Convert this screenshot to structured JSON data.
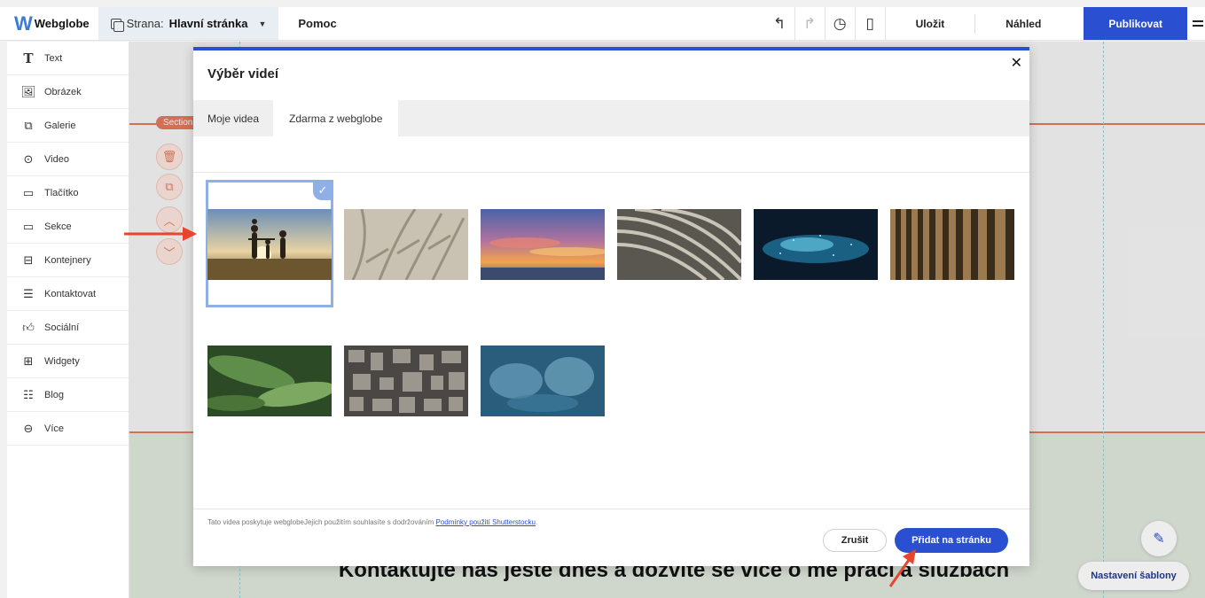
{
  "topbar": {
    "logo_text": "Webglobe",
    "page_prefix": "Strana:",
    "page_name": "Hlavní stránka",
    "help": "Pomoc",
    "save": "Uložit",
    "preview": "Náhled",
    "publish": "Publikovat"
  },
  "sidebar": {
    "items": [
      {
        "label": "Text",
        "icon": "text-icon"
      },
      {
        "label": "Obrázek",
        "icon": "image-icon"
      },
      {
        "label": "Galerie",
        "icon": "gallery-icon"
      },
      {
        "label": "Video",
        "icon": "video-icon"
      },
      {
        "label": "Tlačítko",
        "icon": "button-icon"
      },
      {
        "label": "Sekce",
        "icon": "section-icon"
      },
      {
        "label": "Kontejnery",
        "icon": "container-icon"
      },
      {
        "label": "Kontaktovat",
        "icon": "contact-form-icon"
      },
      {
        "label": "Sociální",
        "icon": "social-icon"
      },
      {
        "label": "Widgety",
        "icon": "widgets-icon"
      },
      {
        "label": "Blog",
        "icon": "blog-icon"
      },
      {
        "label": "Více",
        "icon": "more-icon"
      }
    ]
  },
  "canvas": {
    "section_tag": "Section",
    "heading": "Kontaktujte nás ještě dnes a dozvíte se více o mé práci a službách",
    "template_settings": "Nastavení šablony",
    "accent_color": "#e2785c"
  },
  "modal": {
    "title": "Výběr videí",
    "tabs": [
      "Moje videa",
      "Zdarma z webglobe"
    ],
    "active_tab": "Zdarma z webglobe",
    "videos": [
      {
        "name": "family-sunset-thumbnail",
        "selected": true
      },
      {
        "name": "plant-shadows-thumbnail",
        "selected": false
      },
      {
        "name": "sunset-clouds-thumbnail",
        "selected": false
      },
      {
        "name": "abstract-curves-thumbnail",
        "selected": false
      },
      {
        "name": "digital-particles-thumbnail",
        "selected": false
      },
      {
        "name": "wooden-slats-thumbnail",
        "selected": false
      },
      {
        "name": "green-leaves-thumbnail",
        "selected": false
      },
      {
        "name": "city-aerial-thumbnail",
        "selected": false
      },
      {
        "name": "ocean-waves-thumbnail",
        "selected": false
      }
    ],
    "footer_note": "Tato videa poskytuje webglobeJejich použitím souhlasíte s dodržováním ",
    "footer_link": "Podmínky použití Shutterstocku",
    "footer_period": ".",
    "cancel": "Zrušit",
    "add": "Přidat na stránku",
    "brand_color": "#2a4fd0"
  }
}
